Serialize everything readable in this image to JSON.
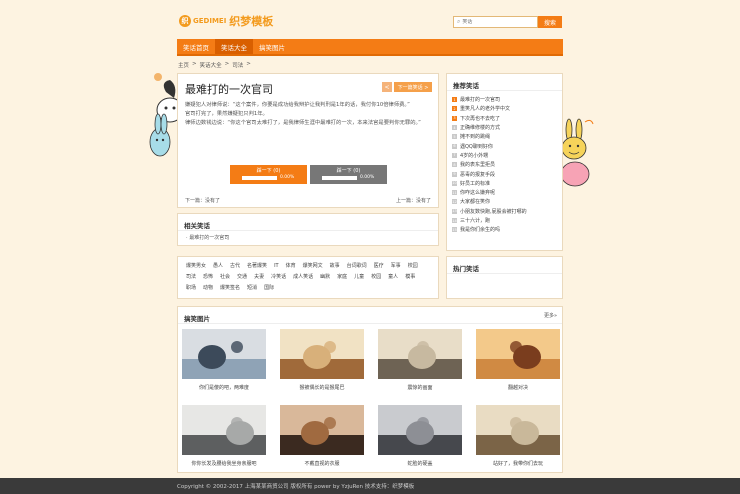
{
  "header": {
    "logo_badge": "织",
    "logo_en": "GEDIMEI",
    "logo_cn": "织梦模板",
    "search_placeholder": "笑话",
    "search_button": "搜索"
  },
  "nav": [
    {
      "label": "笑话首页",
      "active": false
    },
    {
      "label": "笑话大全",
      "active": true
    },
    {
      "label": "搞笑图片",
      "active": false
    }
  ],
  "breadcrumb": [
    "主页",
    ">",
    "笑话大全",
    ">",
    "司法",
    ">"
  ],
  "article": {
    "title": "最难打的一次官司",
    "prev_btn": "<",
    "next_btn": "下一篇笑话 >",
    "paragraphs": [
      "嫌疑犯人对律师说：“这个案件，你要是成功给我辩护让我判刑是1年的话，我付你10倍律师费。”",
      "官司打完了，果然嫌疑犯只判1年。",
      "律师边数钱边说：“你这个官司太难打了，是我律师生涯中最难打的一次，本来法官是要判你无罪的。”"
    ],
    "vote_up_label": "踩一下 (0)",
    "vote_up_pct": "0.00%",
    "vote_down_label": "踩一下 (0)",
    "vote_down_pct": "0.00%",
    "prev_link": "下一篇：没有了",
    "next_link": "上一篇：没有了"
  },
  "related": {
    "title": "相关笑话",
    "items": [
      "最难打的一次官司"
    ]
  },
  "tags": [
    "爆笑男女",
    "愚人",
    "古代",
    "名著爆笑",
    "IT",
    "体育",
    "爆笑网文",
    "故事",
    "台词歌词",
    "医疗",
    "军事",
    "校园",
    "司法",
    "恐怖",
    "社会",
    "交通",
    "夫妻",
    "冷笑话",
    "成人笑话",
    "幽默",
    "家庭",
    "儿童",
    "校园",
    "童人",
    "模事",
    "职场",
    "动物",
    "爆笑签名",
    "短消",
    "国际"
  ],
  "sidebar": {
    "title": "推荐笑话",
    "items": [
      {
        "num": "1",
        "hot": true,
        "text": "最难打的一次官司"
      },
      {
        "num": "2",
        "hot": true,
        "text": "重笑凡人的老外学中文"
      },
      {
        "num": "3",
        "hot": true,
        "text": "下次再也不去吃了"
      },
      {
        "num": "4",
        "hot": false,
        "text": "正确维修楼的方式"
      },
      {
        "num": "5",
        "hot": false,
        "text": "摊不到的跳绳"
      },
      {
        "num": "6",
        "hot": false,
        "text": "遇QQ聊到好你"
      },
      {
        "num": "7",
        "hot": false,
        "text": "4岁的小外甥"
      },
      {
        "num": "8",
        "hot": false,
        "text": "我的表东里拒员"
      },
      {
        "num": "9",
        "hot": false,
        "text": "恶毒的报复手段"
      },
      {
        "num": "10",
        "hot": false,
        "text": "好员工的标准"
      },
      {
        "num": "11",
        "hot": false,
        "text": "你咋这么嫌弃呢"
      },
      {
        "num": "12",
        "hot": false,
        "text": "大家都在笑你"
      },
      {
        "num": "13",
        "hot": false,
        "text": "小朋友数快跑,屁股会被打哪的"
      },
      {
        "num": "14",
        "hot": false,
        "text": "三十六计，跑"
      },
      {
        "num": "15",
        "hot": false,
        "text": "我是你们余生的吗"
      }
    ],
    "hot_title": "热门笑话"
  },
  "pictures": {
    "title": "搞笑图片",
    "more": "更多»",
    "items": [
      {
        "caption": "你们是傻的吧，两难度"
      },
      {
        "caption": "猴被偶长的是猴尾巴"
      },
      {
        "caption": "震惊的画面"
      },
      {
        "caption": "翻越对决"
      },
      {
        "caption": "你你长发及腰给我坐身亲服吧"
      },
      {
        "caption": "不戴直视的衣服"
      },
      {
        "caption": "蛇脸的硬盖"
      },
      {
        "caption": "站好了，我带你们去玩"
      }
    ]
  },
  "footer": "Copyright © 2002-2017 上海某某商贸公司 版权所有 power by YzjuRen    技术支持：织梦模板"
}
